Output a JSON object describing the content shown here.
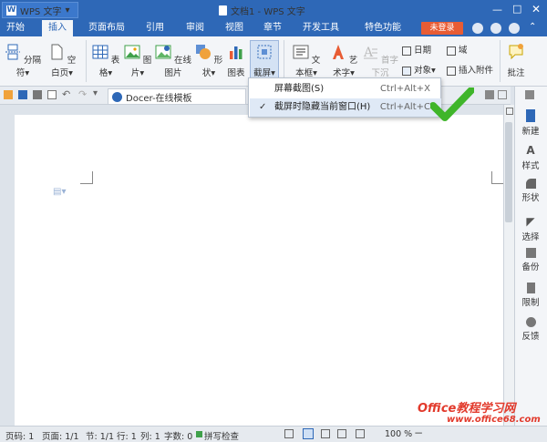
{
  "app": {
    "name": "WPS 文字",
    "doc_title": "文档1 - WPS 文字"
  },
  "tabs": [
    {
      "label": "开始"
    },
    {
      "label": "插入"
    },
    {
      "label": "页面布局"
    },
    {
      "label": "引用"
    },
    {
      "label": "审阅"
    },
    {
      "label": "视图"
    },
    {
      "label": "章节"
    },
    {
      "label": "开发工具"
    },
    {
      "label": "特色功能"
    }
  ],
  "active_tab": "插入",
  "login_label": "未登录",
  "ribbon": {
    "break": "分隔符",
    "blank_page": "空白页",
    "table": "表格",
    "picture": "图片",
    "online_picture": "在线图片",
    "shape": "形状",
    "chart": "图表",
    "screenshot": "截屏",
    "textbox": "文本框",
    "wordart": "艺术字",
    "first_letter": "首字下沉",
    "date": "日期",
    "object": "对象",
    "field": "域",
    "attachment": "插入附件",
    "comment": "批注"
  },
  "doc_tab_label": "Docer-在线模板",
  "menu": {
    "items": [
      {
        "label": "屏幕截图(S)",
        "shortcut": "Ctrl+Alt+X"
      },
      {
        "label": "截屏时隐藏当前窗口(H)",
        "shortcut": "Ctrl+Alt+C",
        "check": "✓"
      }
    ]
  },
  "side_panel": [
    {
      "label": "新建"
    },
    {
      "label": "样式"
    },
    {
      "label": "形状"
    },
    {
      "label": "选择"
    },
    {
      "label": "备份"
    },
    {
      "label": "限制"
    },
    {
      "label": "反馈"
    }
  ],
  "status": {
    "page_no": "页码: 1",
    "pages": "页面: 1/1",
    "section": "节: 1/1",
    "row": "行: 1",
    "col": "列: 1",
    "words": "字数: 0",
    "spell": "拼写检查",
    "zoom": "100 %"
  },
  "watermark": {
    "line1": "Office教程学习网",
    "line2": "www.office68.com"
  },
  "colors": {
    "title_bar": "#2e68b7",
    "login": "#e85c34",
    "checkmark": "#3fb52a",
    "watermark": "#e23a2c"
  }
}
